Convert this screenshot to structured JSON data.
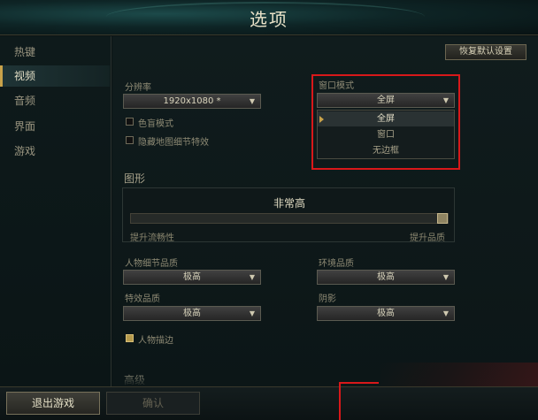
{
  "window": {
    "title": "选项"
  },
  "sidebar": {
    "items": [
      {
        "label": "热键",
        "active": false
      },
      {
        "label": "视频",
        "active": true
      },
      {
        "label": "音频",
        "active": false
      },
      {
        "label": "界面",
        "active": false
      },
      {
        "label": "游戏",
        "active": false
      }
    ]
  },
  "toolbar": {
    "reset_label": "恢复默认设置"
  },
  "resolution": {
    "label": "分辨率",
    "value": "1920x1080 *"
  },
  "checkboxes": {
    "colorblind": {
      "label": "色盲模式",
      "checked": false
    },
    "hide_eye_candy": {
      "label": "隐藏地图细节特效",
      "checked": false
    },
    "character_outline": {
      "label": "人物描边",
      "checked": true
    }
  },
  "window_mode": {
    "label": "窗口模式",
    "value": "全屏",
    "options": [
      "全屏",
      "窗口",
      "无边框"
    ],
    "selected_index": 0
  },
  "graphics": {
    "section_title": "图形",
    "preset_value": "非常高",
    "slider_level_fraction": 1.0,
    "left_hint": "提升流畅性",
    "right_hint": "提升品质"
  },
  "quality": {
    "character": {
      "label": "人物细节品质",
      "value": "极高"
    },
    "environment": {
      "label": "环境品质",
      "value": "极高"
    },
    "effects": {
      "label": "特效品质",
      "value": "极高"
    },
    "shadows": {
      "label": "阴影",
      "value": "极高"
    }
  },
  "advanced": {
    "section_title": "高级"
  },
  "bottom": {
    "exit_label": "退出游戏",
    "confirm_label": "确认"
  },
  "colors": {
    "highlight_box": "#d8181a",
    "accent": "#c9a24a"
  }
}
